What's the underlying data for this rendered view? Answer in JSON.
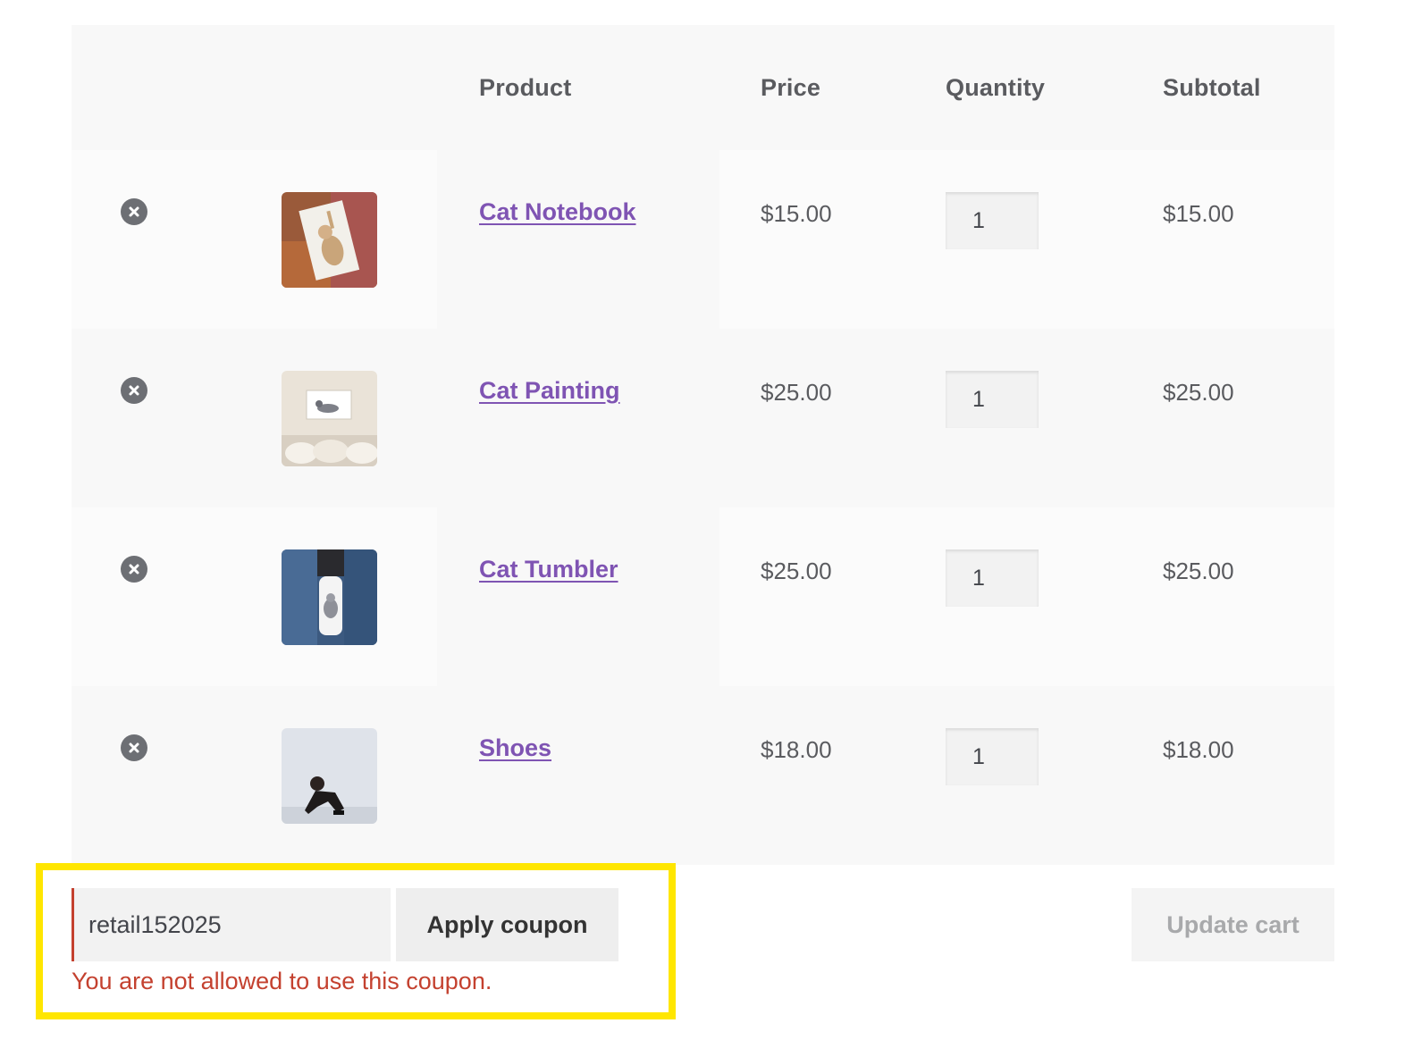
{
  "table": {
    "headers": {
      "product": "Product",
      "price": "Price",
      "quantity": "Quantity",
      "subtotal": "Subtotal"
    },
    "rows": [
      {
        "name": "Cat Notebook",
        "price": "$15.00",
        "quantity": "1",
        "subtotal": "$15.00",
        "thumb_icon": "cat-notebook-image"
      },
      {
        "name": "Cat Painting",
        "price": "$25.00",
        "quantity": "1",
        "subtotal": "$25.00",
        "thumb_icon": "cat-painting-image"
      },
      {
        "name": "Cat Tumbler",
        "price": "$25.00",
        "quantity": "1",
        "subtotal": "$25.00",
        "thumb_icon": "cat-tumbler-image"
      },
      {
        "name": "Shoes",
        "price": "$18.00",
        "quantity": "1",
        "subtotal": "$18.00",
        "thumb_icon": "shoes-image"
      }
    ],
    "remove_icon": "close-circle-icon"
  },
  "coupon": {
    "value": "retail152025",
    "apply_label": "Apply coupon",
    "error": "You are not allowed to use this coupon."
  },
  "actions": {
    "update_label": "Update cart"
  },
  "colors": {
    "link": "#7f54b3",
    "error": "#c4412f",
    "highlight": "#ffe600"
  }
}
